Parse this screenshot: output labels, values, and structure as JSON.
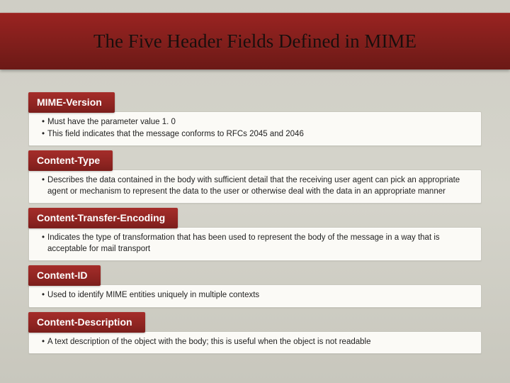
{
  "title": "The Five Header Fields Defined in MIME",
  "sections": [
    {
      "heading": "MIME-Version",
      "bullets": [
        "Must have the parameter value 1. 0",
        "This field indicates that the message conforms to RFCs 2045 and 2046"
      ]
    },
    {
      "heading": "Content-Type",
      "bullets": [
        "Describes the data contained in the body with sufficient detail that the receiving user agent can pick an appropriate agent or mechanism to represent the data to the user or otherwise deal with the data in an appropriate manner"
      ]
    },
    {
      "heading": "Content-Transfer-Encoding",
      "bullets": [
        "Indicates the type of transformation that has been used to represent the body of the message in a way that is acceptable for mail transport"
      ]
    },
    {
      "heading": "Content-ID",
      "bullets": [
        "Used to identify MIME entities uniquely in multiple contexts"
      ]
    },
    {
      "heading": "Content-Description",
      "bullets": [
        "A text description of the object with the body;  this is useful when the object is not readable"
      ]
    }
  ]
}
